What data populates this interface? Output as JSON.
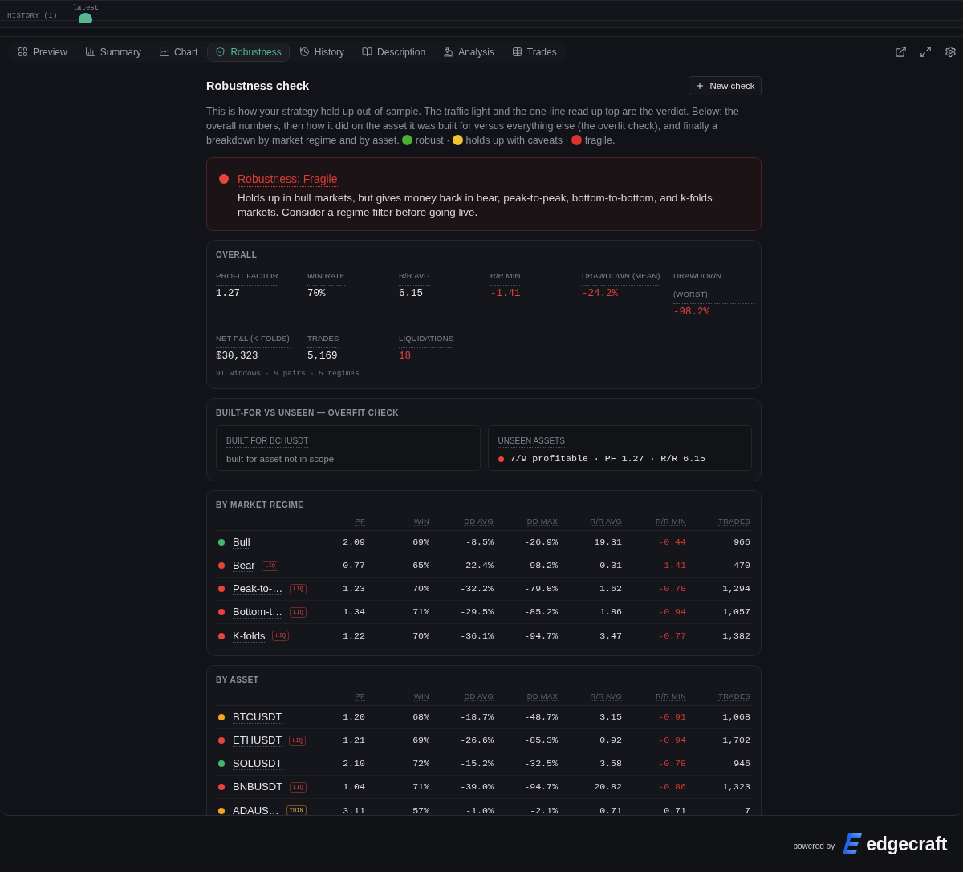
{
  "history": {
    "label": "HISTORY (1)",
    "points": [
      {
        "label": "latest",
        "selected": true
      }
    ]
  },
  "tabs": [
    {
      "label": "Preview",
      "selected": false
    },
    {
      "label": "Summary",
      "selected": false
    },
    {
      "label": "Chart",
      "selected": false
    },
    {
      "label": "Robustness",
      "selected": true
    },
    {
      "label": "History",
      "selected": false
    },
    {
      "label": "Description",
      "selected": false
    },
    {
      "label": "Analysis",
      "selected": false
    },
    {
      "label": "Trades",
      "selected": false
    }
  ],
  "header": {
    "title": "Robustness check",
    "button": "New check"
  },
  "description": {
    "text": "This is how your strategy held up out-of-sample. The traffic light and the one-line read up top are the verdict. Below: the overall numbers, then how it did on the asset it was built for versus everything else (the overfit check), and finally a breakdown by market regime and by asset.",
    "legend": [
      {
        "color": "#4caf2e",
        "label": "robust ·"
      },
      {
        "color": "#f4c430",
        "label": "holds up with caveats ·"
      },
      {
        "color": "#d9352c",
        "label": "fragile."
      }
    ]
  },
  "verdict": {
    "kind": "fragile",
    "title": "Robustness: Fragile",
    "text": "Holds up in bull markets, but gives money back in bear, peak-to-peak, bottom-to-bottom, and k-folds markets. Consider a regime filter before going live."
  },
  "overall": {
    "title": "OVERALL",
    "metrics": [
      {
        "label": "PROFIT FACTOR",
        "value": "1.27",
        "alert": false
      },
      {
        "label": "WIN RATE",
        "value": "70%",
        "alert": false
      },
      {
        "label": "R/R AVG",
        "value": "6.15",
        "alert": false
      },
      {
        "label": "R/R MIN",
        "value": "-1.41",
        "alert": true
      },
      {
        "label": "DRAWDOWN (MEAN)",
        "value": "-24.2%",
        "alert": true
      },
      {
        "label": "DRAWDOWN (WORST)",
        "value": "-98.2%",
        "alert": true
      },
      {
        "label": "NET P&L (K-FOLDS)",
        "value": "$30,323",
        "alert": false
      },
      {
        "label": "TRADES",
        "value": "5,169",
        "alert": false
      },
      {
        "label": "LIQUIDATIONS",
        "value": "18",
        "alert": true
      }
    ],
    "footnote": "91 windows · 9 pairs · 5 regimes"
  },
  "overfit": {
    "title": "BUILT-FOR VS UNSEEN — OVERFIT CHECK",
    "built_for": {
      "label": "BUILT FOR BCHUSDT",
      "text": "built-for asset not in scope"
    },
    "unseen": {
      "label": "UNSEEN ASSETS",
      "kind": "fragile",
      "text": "7/9 profitable · PF 1.27 · R/R 6.15"
    }
  },
  "regimes": {
    "title": "BY MARKET REGIME",
    "columns": [
      "PF",
      "WIN",
      "DD AVG",
      "DD MAX",
      "R/R AVG",
      "R/R MIN",
      "TRADES"
    ],
    "rows": [
      {
        "name": "Bull",
        "color": "#3fb86b",
        "cells": [
          {
            "text": "2.09",
            "alert": false
          },
          {
            "text": "69%",
            "alert": false
          },
          {
            "text": "-8.5%",
            "alert": false
          },
          {
            "text": "-26.9%",
            "alert": false
          },
          {
            "text": "19.31",
            "alert": false
          },
          {
            "text": "-0.44",
            "alert": true
          },
          {
            "text": "966",
            "alert": false
          }
        ]
      },
      {
        "name": "Bear",
        "color": "#e5453b",
        "badge": {
          "text": "LIQ",
          "kind": "danger"
        },
        "cells": [
          {
            "text": "0.77",
            "alert": false
          },
          {
            "text": "65%",
            "alert": false
          },
          {
            "text": "-22.4%",
            "alert": false
          },
          {
            "text": "-98.2%",
            "alert": false
          },
          {
            "text": "0.31",
            "alert": false
          },
          {
            "text": "-1.41",
            "alert": true
          },
          {
            "text": "470",
            "alert": false
          }
        ]
      },
      {
        "name": "Peak-to-…",
        "color": "#e5453b",
        "badge": {
          "text": "LIQ",
          "kind": "danger"
        },
        "cells": [
          {
            "text": "1.23",
            "alert": false
          },
          {
            "text": "70%",
            "alert": false
          },
          {
            "text": "-32.2%",
            "alert": false
          },
          {
            "text": "-79.8%",
            "alert": false
          },
          {
            "text": "1.62",
            "alert": false
          },
          {
            "text": "-0.78",
            "alert": true
          },
          {
            "text": "1,294",
            "alert": false
          }
        ]
      },
      {
        "name": "Bottom-t…",
        "color": "#e5453b",
        "badge": {
          "text": "LIQ",
          "kind": "danger"
        },
        "cells": [
          {
            "text": "1.34",
            "alert": false
          },
          {
            "text": "71%",
            "alert": false
          },
          {
            "text": "-29.5%",
            "alert": false
          },
          {
            "text": "-85.2%",
            "alert": false
          },
          {
            "text": "1.86",
            "alert": false
          },
          {
            "text": "-0.94",
            "alert": true
          },
          {
            "text": "1,057",
            "alert": false
          }
        ]
      },
      {
        "name": "K-folds",
        "color": "#e5453b",
        "badge": {
          "text": "LIQ",
          "kind": "danger"
        },
        "cells": [
          {
            "text": "1.22",
            "alert": false
          },
          {
            "text": "70%",
            "alert": false
          },
          {
            "text": "-36.1%",
            "alert": false
          },
          {
            "text": "-94.7%",
            "alert": false
          },
          {
            "text": "3.47",
            "alert": false
          },
          {
            "text": "-0.77",
            "alert": true
          },
          {
            "text": "1,382",
            "alert": false
          }
        ]
      }
    ]
  },
  "assets": {
    "title": "BY ASSET",
    "columns": [
      "PF",
      "WIN",
      "DD AVG",
      "DD MAX",
      "R/R AVG",
      "R/R MIN",
      "TRADES"
    ],
    "rows": [
      {
        "name": "BTCUSDT",
        "color": "#f5a524",
        "cells": [
          {
            "text": "1.20",
            "alert": false
          },
          {
            "text": "68%",
            "alert": false
          },
          {
            "text": "-18.7%",
            "alert": false
          },
          {
            "text": "-48.7%",
            "alert": false
          },
          {
            "text": "3.15",
            "alert": false
          },
          {
            "text": "-0.91",
            "alert": true
          },
          {
            "text": "1,068",
            "alert": false
          }
        ]
      },
      {
        "name": "ETHUSDT",
        "color": "#e5453b",
        "badge": {
          "text": "LIQ",
          "kind": "danger"
        },
        "cells": [
          {
            "text": "1.21",
            "alert": false
          },
          {
            "text": "69%",
            "alert": false
          },
          {
            "text": "-26.6%",
            "alert": false
          },
          {
            "text": "-85.3%",
            "alert": false
          },
          {
            "text": "0.92",
            "alert": false
          },
          {
            "text": "-0.94",
            "alert": true
          },
          {
            "text": "1,702",
            "alert": false
          }
        ]
      },
      {
        "name": "SOLUSDT",
        "color": "#3fb86b",
        "cells": [
          {
            "text": "2.10",
            "alert": false
          },
          {
            "text": "72%",
            "alert": false
          },
          {
            "text": "-15.2%",
            "alert": false
          },
          {
            "text": "-32.5%",
            "alert": false
          },
          {
            "text": "3.58",
            "alert": false
          },
          {
            "text": "-0.78",
            "alert": true
          },
          {
            "text": "946",
            "alert": false
          }
        ]
      },
      {
        "name": "BNBUSDT",
        "color": "#e5453b",
        "badge": {
          "text": "LIQ",
          "kind": "danger"
        },
        "cells": [
          {
            "text": "1.04",
            "alert": false
          },
          {
            "text": "71%",
            "alert": false
          },
          {
            "text": "-39.0%",
            "alert": false
          },
          {
            "text": "-94.7%",
            "alert": false
          },
          {
            "text": "20.82",
            "alert": false
          },
          {
            "text": "-0.86",
            "alert": true
          },
          {
            "text": "1,323",
            "alert": false
          }
        ]
      },
      {
        "name": "ADAUS…",
        "color": "#f5a524",
        "badge": {
          "text": "THIN",
          "kind": "warning"
        },
        "cells": [
          {
            "text": "3.11",
            "alert": false
          },
          {
            "text": "57%",
            "alert": false
          },
          {
            "text": "-1.0%",
            "alert": false
          },
          {
            "text": "-2.1%",
            "alert": false
          },
          {
            "text": "0.71",
            "alert": false
          },
          {
            "text": "0.71",
            "alert": false
          },
          {
            "text": "7",
            "alert": false
          }
        ]
      }
    ]
  },
  "footer": {
    "powered_by": "powered by",
    "brand": "edgecraft"
  }
}
